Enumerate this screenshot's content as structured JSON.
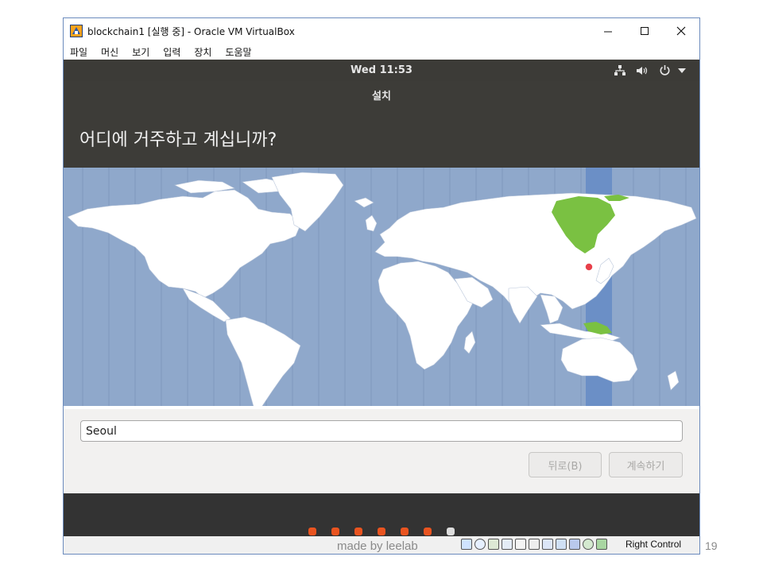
{
  "window": {
    "title": "blockchain1 [실행 중] - Oracle VM VirtualBox",
    "controls": {
      "minimize": "—",
      "maximize": "☐",
      "close": "✕"
    }
  },
  "menubar": {
    "items": [
      "파일",
      "머신",
      "보기",
      "입력",
      "장치",
      "도움말"
    ]
  },
  "guest": {
    "clock": "Wed 11:53",
    "tray_icons": [
      "network-icon",
      "volume-icon",
      "power-icon",
      "chevron-down-icon"
    ]
  },
  "installer": {
    "header_title": "설치",
    "question": "어디에 거주하고 계십니까?",
    "location_value": "Seoul",
    "back_label": "뒤로(B)",
    "continue_label": "계속하기"
  },
  "progress": {
    "total": 7,
    "completed": 6,
    "done_color": "#e95420",
    "current_color": "#dddddd"
  },
  "statusbar": {
    "host_key": "Right Control"
  },
  "footer": {
    "watermark": "made by leelab",
    "page_number": "19"
  },
  "colors": {
    "selected_timezone": "#7ac142",
    "timezone_band": "#6b8fc6",
    "ocean": "#8fa8cb",
    "land": "#ffffff"
  }
}
